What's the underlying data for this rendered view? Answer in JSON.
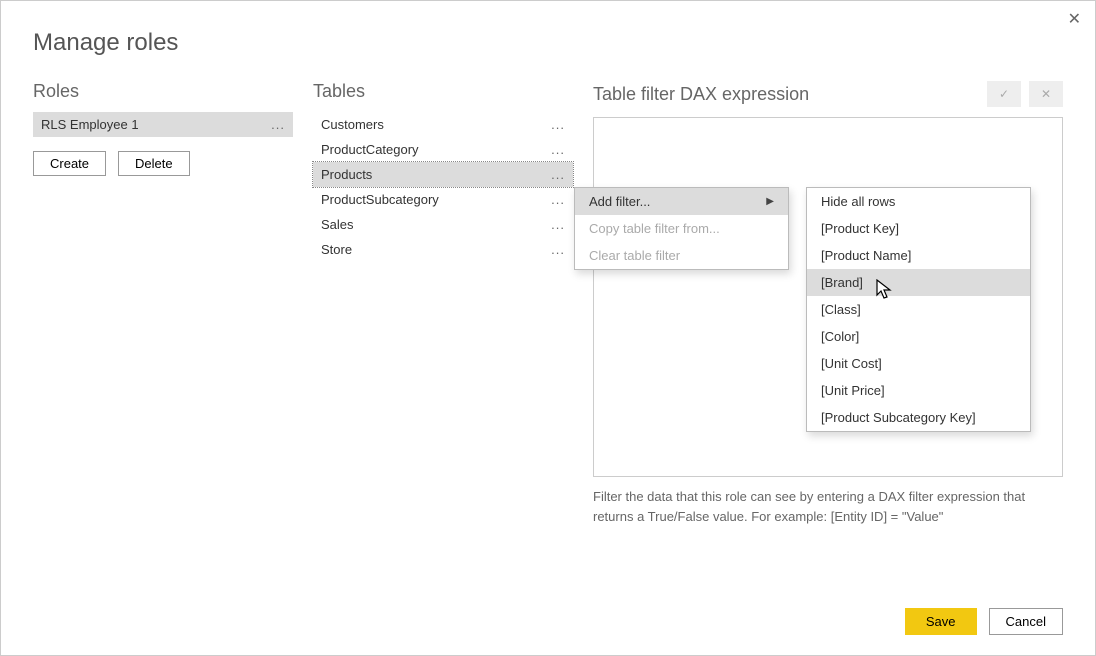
{
  "dialog": {
    "title": "Manage roles"
  },
  "close_x": "✕",
  "roles": {
    "header": "Roles",
    "items": [
      {
        "label": "RLS Employee 1"
      }
    ],
    "create_label": "Create",
    "delete_label": "Delete"
  },
  "tables": {
    "header": "Tables",
    "items": [
      {
        "label": "Customers"
      },
      {
        "label": "ProductCategory"
      },
      {
        "label": "Products"
      },
      {
        "label": "ProductSubcategory"
      },
      {
        "label": "Sales"
      },
      {
        "label": "Store"
      }
    ]
  },
  "dax": {
    "header": "Table filter DAX expression",
    "check": "✓",
    "cross": "✕",
    "hint": "Filter the data that this role can see by entering a DAX filter expression that returns a True/False value. For example: [Entity ID] = \"Value\""
  },
  "ctx1": {
    "add_filter": "Add filter...",
    "copy_from": "Copy table filter from...",
    "clear": "Clear table filter"
  },
  "ctx2": {
    "hide_all": "Hide all rows",
    "items": [
      "[Product Key]",
      "[Product Name]",
      "[Brand]",
      "[Class]",
      "[Color]",
      "[Unit Cost]",
      "[Unit Price]",
      "[Product Subcategory Key]"
    ]
  },
  "footer": {
    "save": "Save",
    "cancel": "Cancel"
  },
  "ellipsis": "..."
}
